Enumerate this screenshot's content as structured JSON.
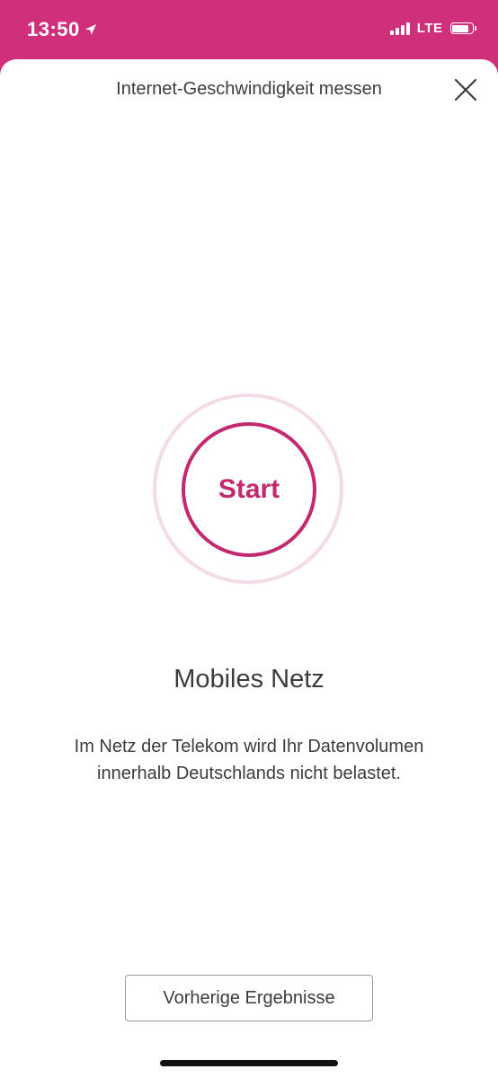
{
  "status_bar": {
    "time": "13:50",
    "network_type": "LTE",
    "signal_bars": 4,
    "battery_level": 0.9,
    "icons": [
      "location-arrow-icon",
      "signal-icon",
      "battery-icon"
    ],
    "color": "#ffffff"
  },
  "header": {
    "title": "Internet-Geschwindigkeit messen",
    "close_icon": "close-icon"
  },
  "speed_test": {
    "start_label": "Start",
    "accent_color": "#c2296f",
    "halo_color": "#f3dbe8"
  },
  "network_info": {
    "title": "Mobiles Netz",
    "description": "Im Netz der Telekom wird Ihr Datenvolumen innerhalb Deutschlands nicht belastet."
  },
  "footer": {
    "previous_results_label": "Vorherige Ergebnisse"
  },
  "theme": {
    "brand_color": "#cf2f7b",
    "text_color": "#3c3c3c",
    "background": "#ffffff"
  }
}
